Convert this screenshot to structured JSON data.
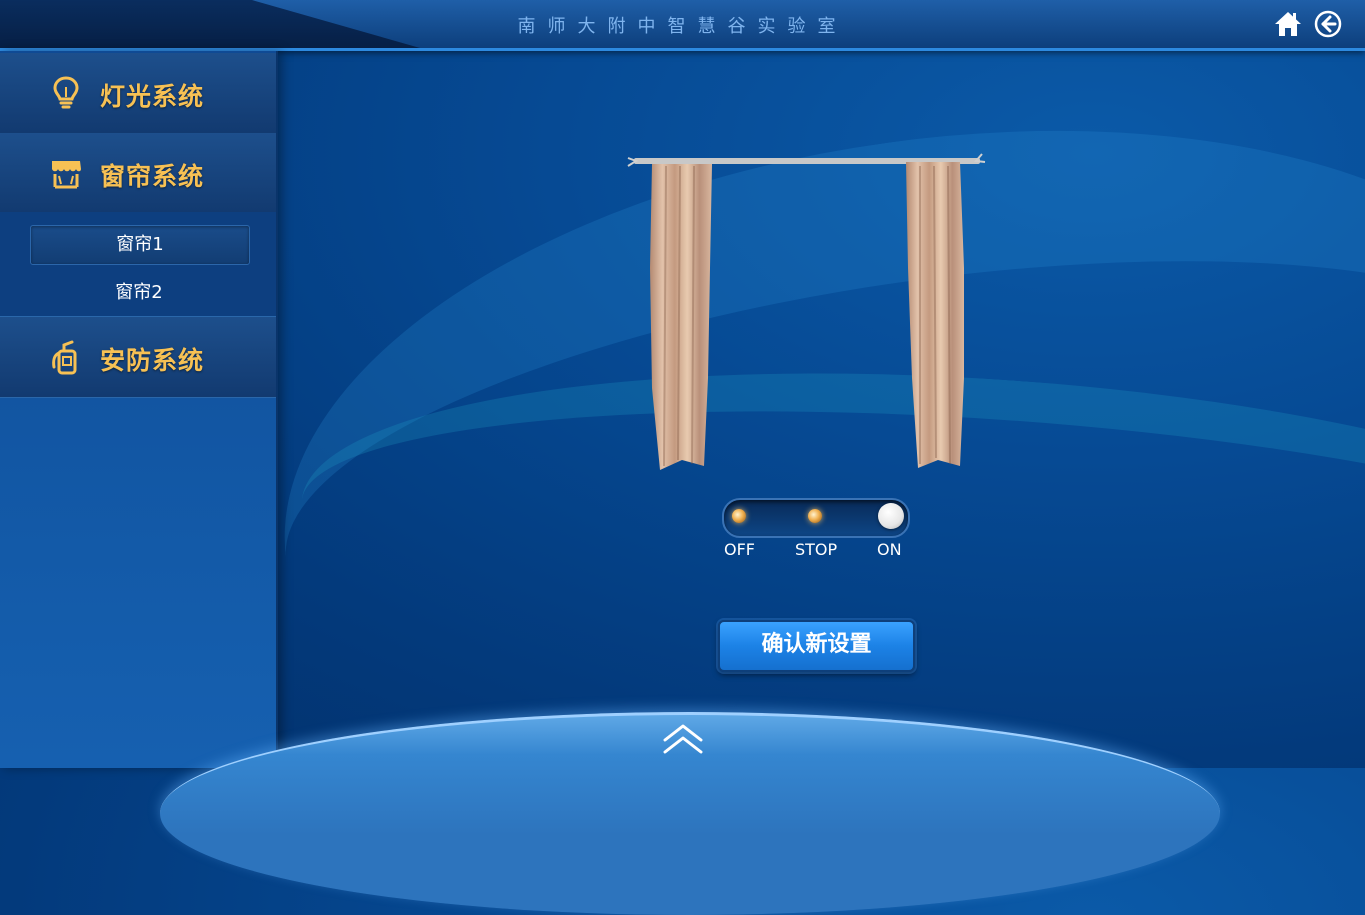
{
  "header": {
    "title": "南师大附中智慧谷实验室",
    "home_icon": "home-icon",
    "back_icon": "back-arrow-icon"
  },
  "sidebar": {
    "sections": [
      {
        "label": "灯光系统",
        "icon": "lightbulb-icon"
      },
      {
        "label": "窗帘系统",
        "icon": "awning-icon"
      },
      {
        "label": "安防系统",
        "icon": "fire-extinguisher-icon"
      }
    ],
    "curtain_items": [
      {
        "label": "窗帘1",
        "active": true
      },
      {
        "label": "窗帘2",
        "active": false
      }
    ]
  },
  "control": {
    "switch_labels": {
      "off": "OFF",
      "stop": "STOP",
      "on": "ON"
    },
    "switch_state": "ON",
    "confirm_label": "确认新设置"
  },
  "footer": {
    "expand_icon": "double-chevron-up-icon"
  },
  "colors": {
    "accent_gold": "#f7c154",
    "button_blue": "#1c82e6",
    "title_blue": "#7fb4ee"
  }
}
